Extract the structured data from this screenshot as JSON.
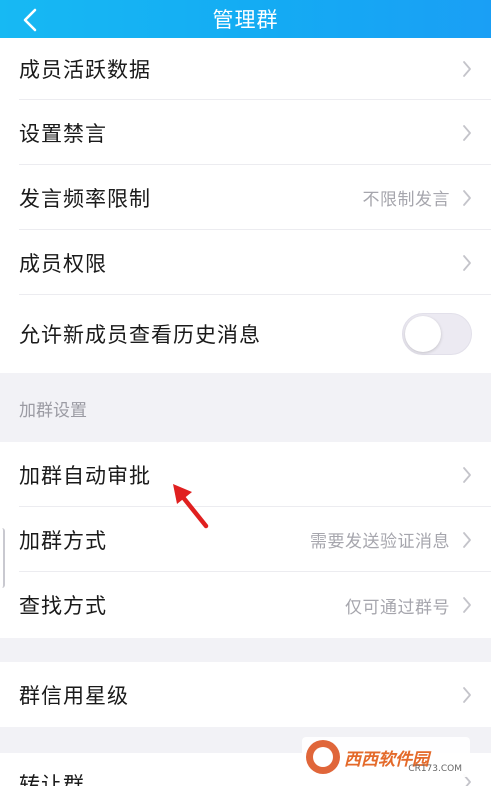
{
  "header": {
    "title": "管理群",
    "back_icon": "chevron-left-icon"
  },
  "group1": {
    "rows": [
      {
        "label": "成员活跃数据",
        "value": ""
      },
      {
        "label": "设置禁言",
        "value": ""
      },
      {
        "label": "发言频率限制",
        "value": "不限制发言"
      },
      {
        "label": "成员权限",
        "value": ""
      }
    ],
    "toggle_row": {
      "label": "允许新成员查看历史消息",
      "toggle_state": "off"
    }
  },
  "join_section": {
    "header": "加群设置",
    "rows": [
      {
        "label": "加群自动审批",
        "value": ""
      },
      {
        "label": "加群方式",
        "value": "需要发送验证消息"
      },
      {
        "label": "查找方式",
        "value": "仅可通过群号"
      }
    ]
  },
  "credit": {
    "label": "群信用星级"
  },
  "transfer": {
    "label": "转让群"
  },
  "annotation": {
    "arrow_color": "#e02020"
  },
  "watermark": {
    "text": "西西软件园",
    "url": "CR173.COM"
  },
  "colors": {
    "header": "#17b9f3",
    "page_bg": "#f2f2f6"
  }
}
